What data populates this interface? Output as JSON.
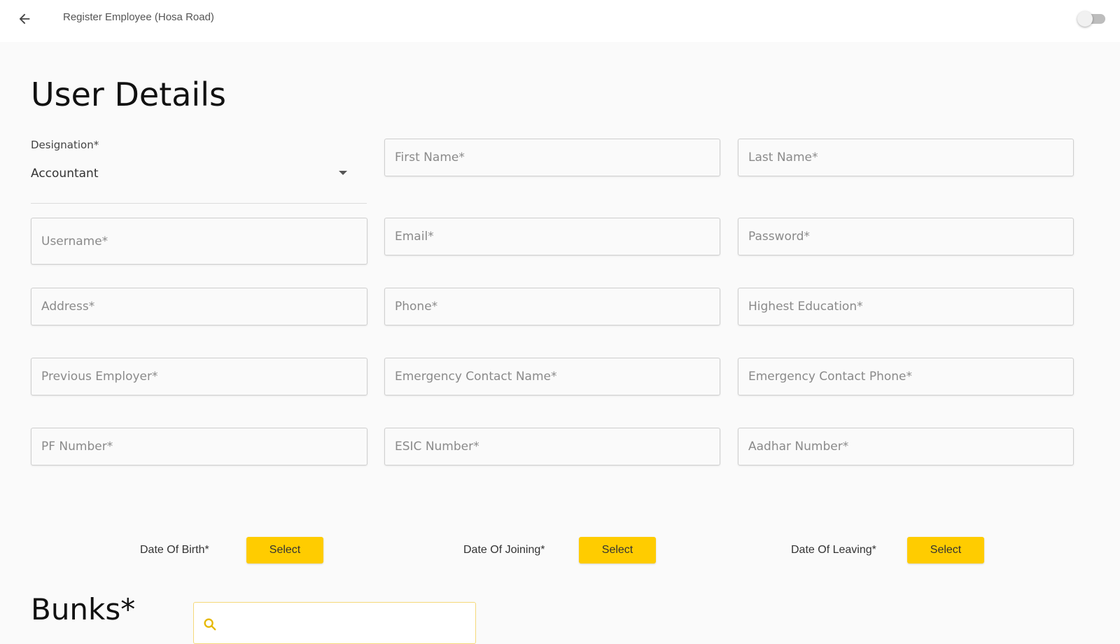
{
  "header": {
    "title": "Register Employee (Hosa Road)",
    "icons": {
      "back": "arrow-left-icon"
    },
    "toggle_on": false
  },
  "page": {
    "title": "User Details"
  },
  "designation": {
    "label": "Designation*",
    "value": "Accountant"
  },
  "fields": {
    "first_name": "First Name*",
    "last_name": "Last Name*",
    "username": "Username*",
    "email": "Email*",
    "password": "Password*",
    "address": "Address*",
    "phone": "Phone*",
    "highest_education": "Highest Education*",
    "previous_employer": "Previous Employer*",
    "emergency_contact_name": "Emergency Contact Name*",
    "emergency_contact_phone": "Emergency Contact Phone*",
    "pf_number": "PF Number*",
    "esic_number": "ESIC Number*",
    "aadhar_number": "Aadhar Number*"
  },
  "dates": {
    "dob_label": "Date Of Birth*",
    "doj_label": "Date Of Joining*",
    "dol_label": "Date Of Leaving*",
    "select_label": "Select"
  },
  "bunks": {
    "title": "Bunks*",
    "search_icon": "search-icon"
  },
  "colors": {
    "accent": "#ffcc00",
    "background": "#fafafa",
    "field_border": "#cfcfcf"
  }
}
